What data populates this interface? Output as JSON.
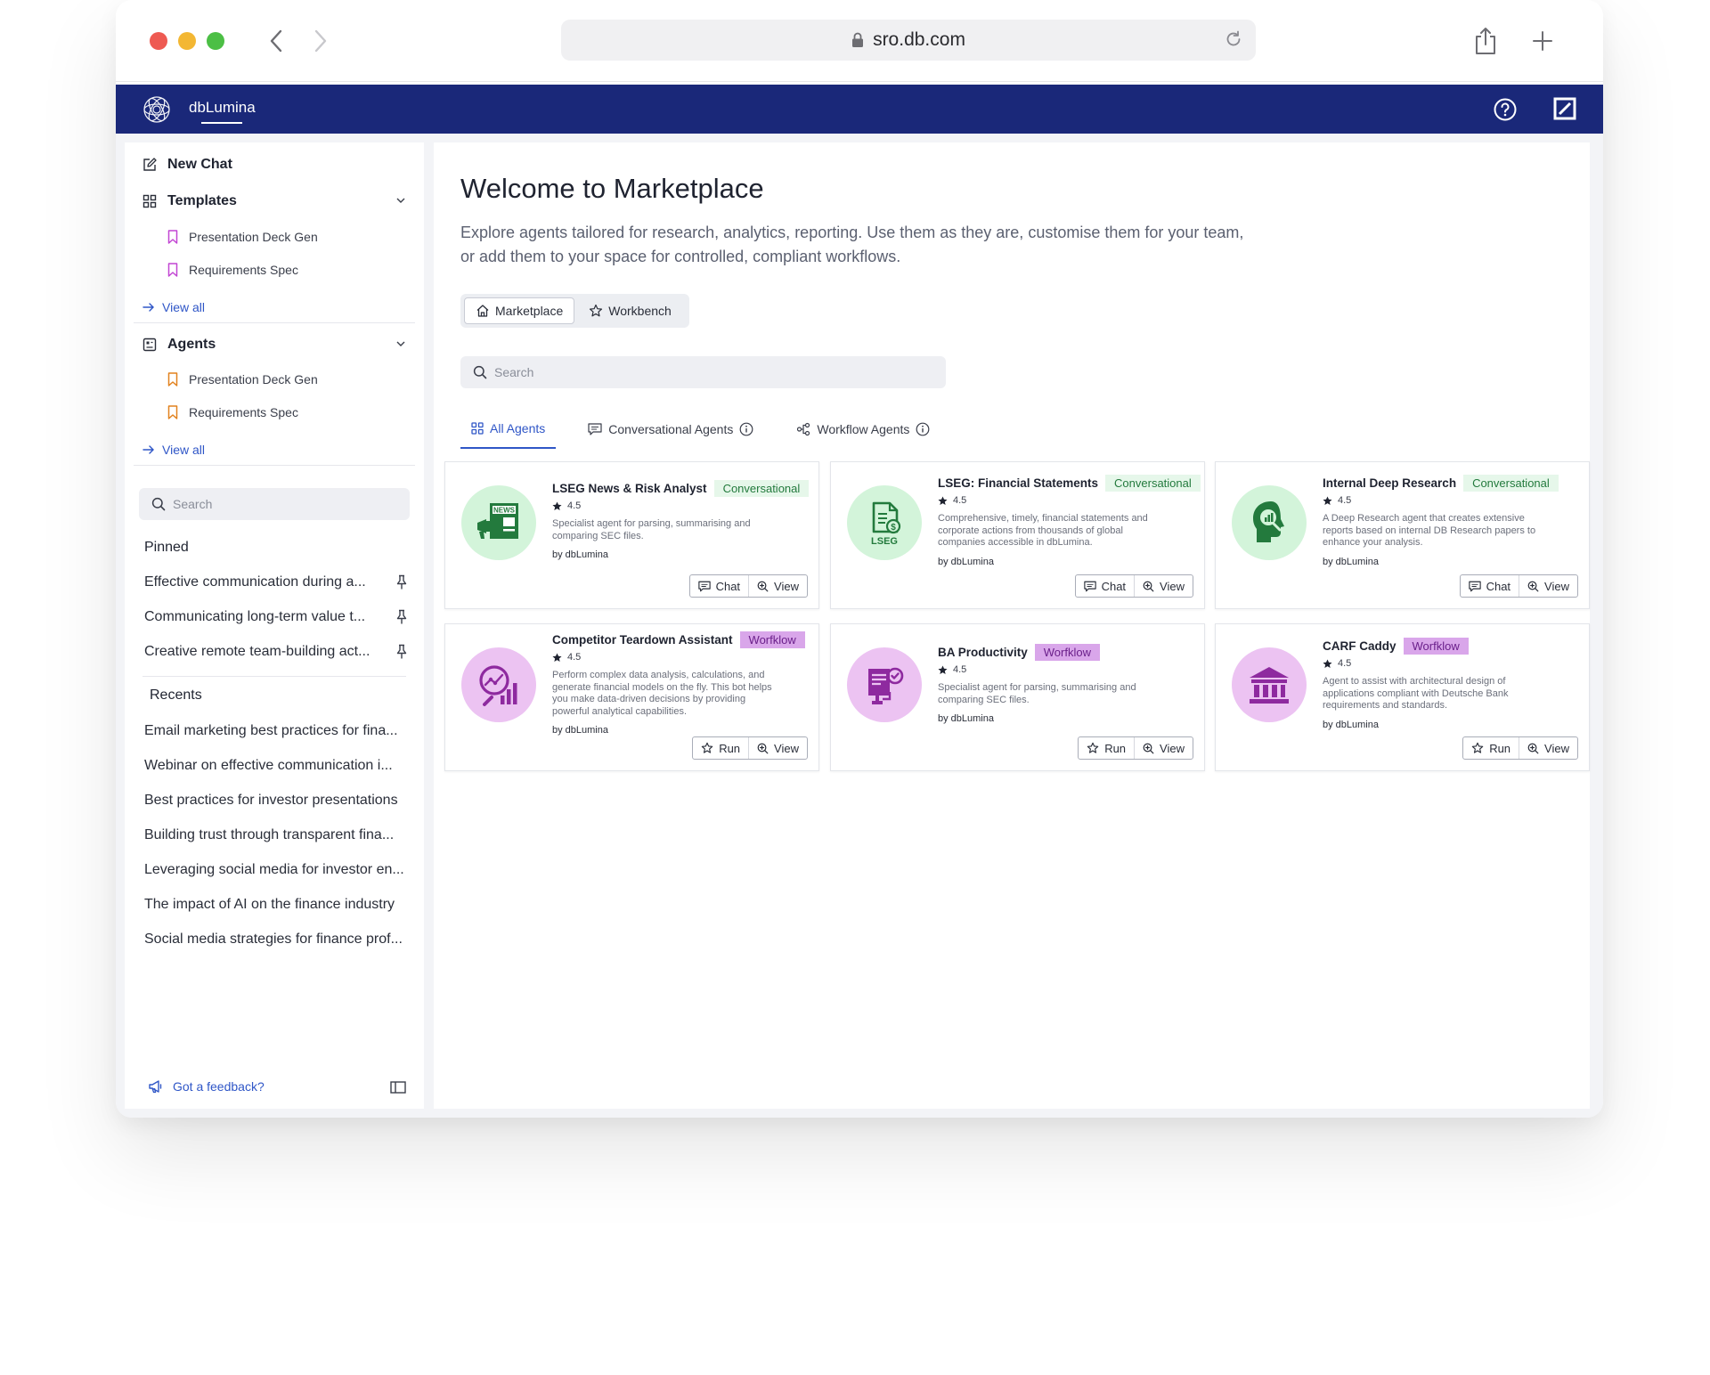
{
  "browser": {
    "url": "sro.db.com"
  },
  "app": {
    "name": "dbLumina"
  },
  "sidebar": {
    "new_chat": "New Chat",
    "templates": {
      "heading": "Templates",
      "items": [
        "Presentation Deck Gen",
        "Requirements Spec"
      ],
      "view_all": "View all"
    },
    "agents": {
      "heading": "Agents",
      "items": [
        "Presentation Deck Gen",
        "Requirements Spec"
      ],
      "view_all": "View all"
    },
    "search_placeholder": "Search",
    "pinned_heading": "Pinned",
    "pinned": [
      "Effective communication during a...",
      "Communicating long-term value t...",
      "Creative remote team-building act..."
    ],
    "recents_heading": "Recents",
    "recents": [
      "Email marketing best practices for fina...",
      "Webinar on effective communication i...",
      "Best practices for investor presentations",
      "Building trust through transparent fina...",
      "Leveraging social media for investor en...",
      "The impact of AI on the finance industry",
      "Social media strategies for finance prof..."
    ],
    "feedback": "Got a feedback?"
  },
  "main": {
    "title": "Welcome to Marketplace",
    "subtitle": "Explore agents tailored for research, analytics, reporting. Use them as they are, customise them for your team, or add them to your space for controlled, compliant workflows.",
    "segments": [
      "Marketplace",
      "Workbench"
    ],
    "search_placeholder": "Search",
    "tabs": [
      "All Agents",
      "Conversational Agents",
      "Workflow Agents"
    ],
    "cards": [
      {
        "title": "LSEG News & Risk Analyst",
        "badge": "Conversational",
        "rating": "4.5",
        "description": "Specialist agent for parsing, summarising and comparing SEC files.",
        "by": "by dbLumina",
        "icon": "news-megaphone-icon",
        "actions": [
          "Chat",
          "View"
        ]
      },
      {
        "title": "LSEG: Financial Statements",
        "badge": "Conversational",
        "rating": "4.5",
        "description": "Comprehensive, timely, financial statements and corporate actions from thousands of global companies accessible in dbLumina.",
        "by": "by dbLumina",
        "icon": "lseg-document-icon",
        "actions": [
          "Chat",
          "View"
        ]
      },
      {
        "title": "Internal Deep Research",
        "badge": "Conversational",
        "rating": "4.5",
        "description": "A Deep Research agent that creates extensive reports based on internal DB Research papers to enhance your analysis.",
        "by": "by dbLumina",
        "icon": "head-research-icon",
        "actions": [
          "Chat",
          "View"
        ]
      },
      {
        "title": "Competitor Teardown Assistant",
        "badge": "Worfklow",
        "rating": "4.5",
        "description": "Perform complex data analysis, calculations, and generate financial models on the fly. This bot helps you make data-driven decisions by providing powerful analytical capabilities.",
        "by": "by dbLumina",
        "icon": "chart-magnifier-icon",
        "actions": [
          "Run",
          "View"
        ]
      },
      {
        "title": "BA Productivity",
        "badge": "Worfklow",
        "rating": "4.5",
        "description": "Specialist agent for parsing, summarising and comparing SEC files.",
        "by": "by dbLumina",
        "icon": "document-check-icon",
        "actions": [
          "Run",
          "View"
        ]
      },
      {
        "title": "CARF Caddy",
        "badge": "Worfklow",
        "rating": "4.5",
        "description": "Agent to assist with architectural design of applications compliant with Deutsche Bank requirements and standards.",
        "by": "by dbLumina",
        "icon": "bank-building-icon",
        "actions": [
          "Run",
          "View"
        ]
      }
    ]
  },
  "colors": {
    "appbar": "#1a2879",
    "link": "#2f56c7",
    "conversational_badge": "#e6f7ea",
    "workflow_badge": "#d9a6ea",
    "green_icon": "#237a3d",
    "purple_icon": "#8e2a9f"
  }
}
